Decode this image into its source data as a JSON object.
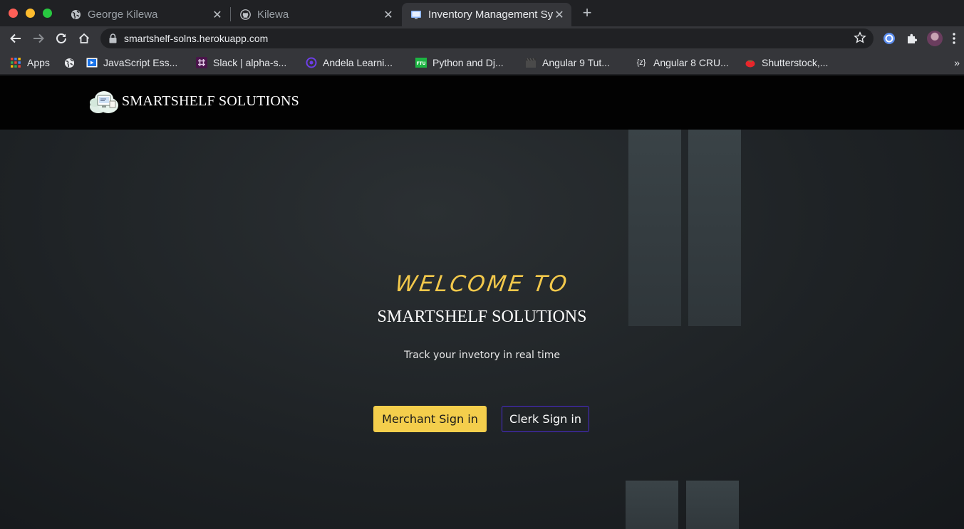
{
  "browser": {
    "tabs": [
      {
        "title": "George Kilewa",
        "icon": "globe-icon"
      },
      {
        "title": "Kilewa",
        "icon": "github-icon"
      },
      {
        "title": "Inventory Management Sy",
        "icon": "monitor-icon",
        "active": true
      }
    ],
    "url": "smartshelf-solns.herokuapp.com",
    "bookmarks": [
      {
        "label": "Apps",
        "icon": "apps-grid-icon"
      },
      {
        "label": "",
        "icon": "globe-icon"
      },
      {
        "label": "JavaScript Ess...",
        "icon": "video-icon"
      },
      {
        "label": "Slack | alpha-s...",
        "icon": "slack-icon"
      },
      {
        "label": "Andela Learni...",
        "icon": "andela-icon"
      },
      {
        "label": "Python and Dj...",
        "icon": "ftu-icon"
      },
      {
        "label": "Angular 9 Tut...",
        "icon": "clapper-icon"
      },
      {
        "label": "Angular 8 CRU...",
        "icon": "code-icon"
      },
      {
        "label": "Shutterstock,...",
        "icon": "tomato-icon"
      }
    ],
    "more": "»",
    "ftu": "FTU",
    "code": "{z}"
  },
  "site": {
    "brand": "SMARTSHELF SOLUTIONS",
    "welcome": "WELCOME TO",
    "hero_title": "SMARTSHELF SOLUTIONS",
    "tagline": "Track your invetory in real time",
    "merchant_button": "Merchant Sign in",
    "clerk_button": "Clerk Sign in"
  },
  "colors": {
    "accent_yellow": "#f4ce4c",
    "accent_purple": "#4a2bd0",
    "nav_bg": "#020202"
  }
}
